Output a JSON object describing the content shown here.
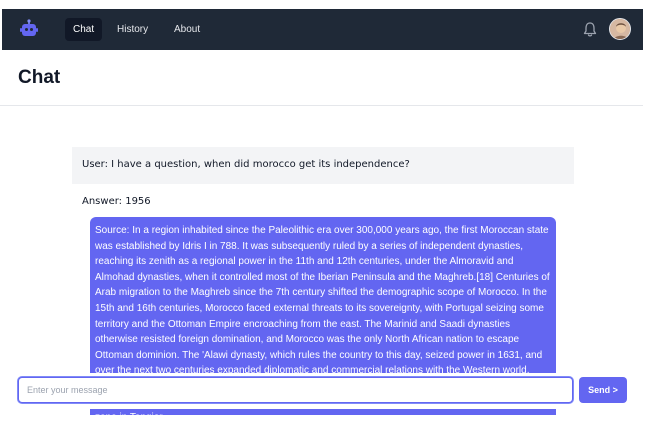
{
  "nav": {
    "tabs": [
      {
        "label": "Chat",
        "active": true
      },
      {
        "label": "History",
        "active": false
      },
      {
        "label": "About",
        "active": false
      }
    ],
    "logo_icon": "robot-icon",
    "notification_icon": "bell-icon"
  },
  "page": {
    "title": "Chat"
  },
  "conversation": {
    "user_message": "User: I have a question, when did morocco get its independence?",
    "answer": "Answer: 1956",
    "source": "Source: In a region inhabited since the Paleolithic era over 300,000 years ago, the first Moroccan state was established by Idris I in 788. It was subsequently ruled by a series of independent dynasties, reaching its zenith as a regional power in the 11th and 12th centuries, under the Almoravid and Almohad dynasties, when it controlled most of the Iberian Peninsula and the Maghreb.[18] Centuries of Arab migration to the Maghreb since the 7th century shifted the demographic scope of Morocco. In the 15th and 16th centuries, Morocco faced external threats to its sovereignty, with Portugal seizing some territory and the Ottoman Empire encroaching from the east. The Marinid and Saadi dynasties otherwise resisted foreign domination, and Morocco was the only North African nation to escape Ottoman dominion. The 'Alawi dynasty, which rules the country to this day, seized power in 1631, and over the next two centuries expanded diplomatic and commercial relations with the Western world. Morocco's strategic location near the mouth of the Mediterranean drew renewed European interest; in 1912, France and Spain divided the country into respective protectorates, reserving an international zone in Tangier."
  },
  "composer": {
    "placeholder": "Enter your message",
    "value": "",
    "send_label": "Send >"
  },
  "colors": {
    "topbar": "#1f2937",
    "accent": "#6366f1",
    "user_bubble": "#f3f4f6"
  }
}
